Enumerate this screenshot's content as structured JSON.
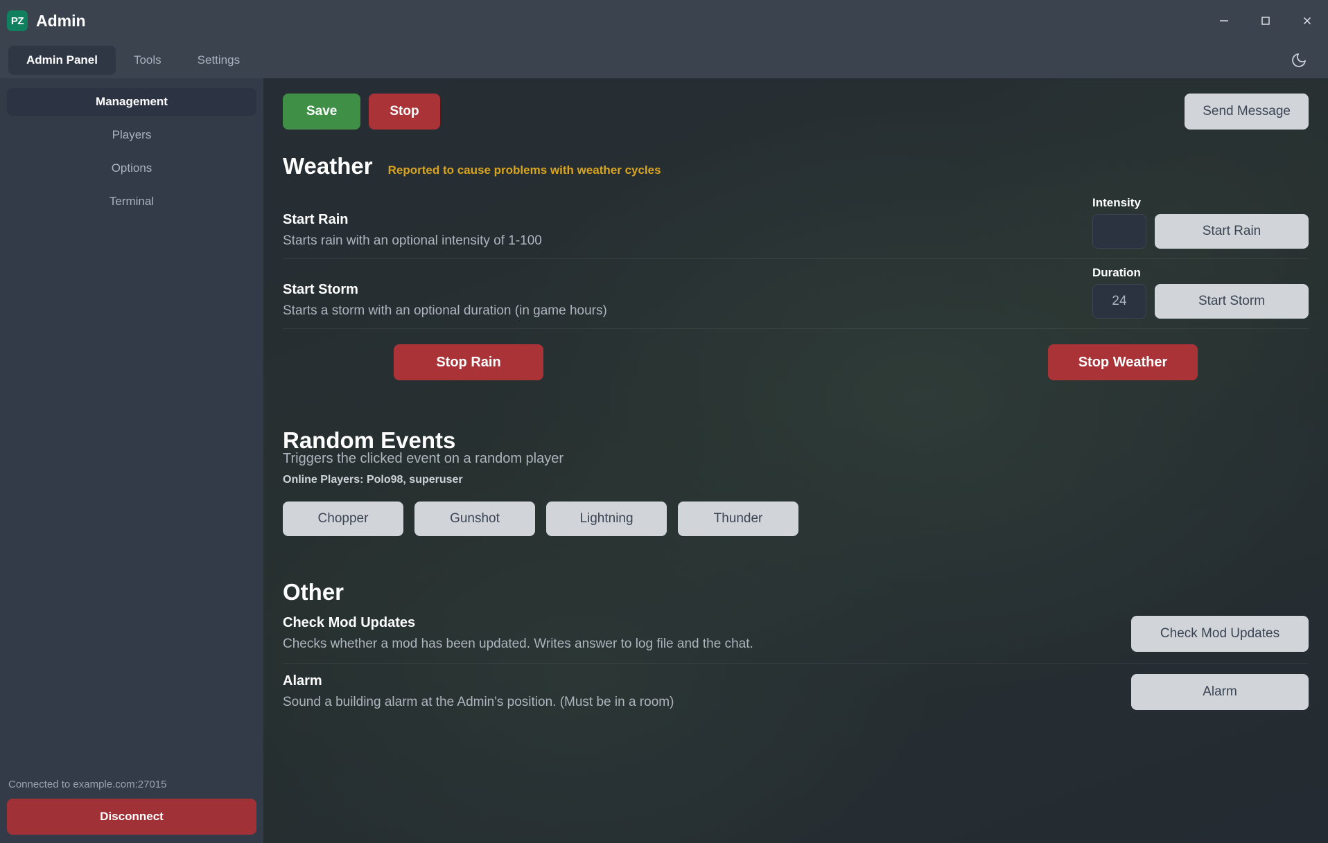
{
  "window": {
    "logo_text": "PZ",
    "title": "Admin",
    "minimize_icon": "minimize-icon",
    "maximize_icon": "maximize-icon",
    "close_icon": "close-icon"
  },
  "nav": {
    "tabs": [
      {
        "label": "Admin Panel",
        "active": true
      },
      {
        "label": "Tools",
        "active": false
      },
      {
        "label": "Settings",
        "active": false
      }
    ],
    "theme_toggle_icon": "moon-icon"
  },
  "sidebar": {
    "items": [
      {
        "label": "Management",
        "active": true
      },
      {
        "label": "Players",
        "active": false
      },
      {
        "label": "Options",
        "active": false
      },
      {
        "label": "Terminal",
        "active": false
      }
    ],
    "connection_status": "Connected to example.com:27015",
    "disconnect_label": "Disconnect"
  },
  "toolbar": {
    "save_label": "Save",
    "stop_label": "Stop",
    "send_message_label": "Send Message"
  },
  "weather": {
    "title": "Weather",
    "warning": "Reported to cause problems with weather cycles",
    "rows": [
      {
        "title": "Start Rain",
        "desc": "Starts rain with an optional intensity of 1-100",
        "field_label": "Intensity",
        "field_value": "",
        "field_placeholder": "",
        "button_label": "Start Rain"
      },
      {
        "title": "Start Storm",
        "desc": "Starts a storm with an optional duration (in game hours)",
        "field_label": "Duration",
        "field_value": "24",
        "field_placeholder": "24",
        "button_label": "Start Storm"
      }
    ],
    "stop_rain_label": "Stop Rain",
    "stop_weather_label": "Stop Weather"
  },
  "random_events": {
    "title": "Random Events",
    "subtitle": "Triggers the clicked event on a random player",
    "online_players": "Online Players: Polo98, superuser",
    "buttons": [
      {
        "label": "Chopper"
      },
      {
        "label": "Gunshot"
      },
      {
        "label": "Lightning"
      },
      {
        "label": "Thunder"
      }
    ]
  },
  "other": {
    "title": "Other",
    "rows": [
      {
        "title": "Check Mod Updates",
        "desc": "Checks whether a mod has been updated. Writes answer to log file and the chat.",
        "button_label": "Check Mod Updates"
      },
      {
        "title": "Alarm",
        "desc": "Sound a building alarm at the Admin's position. (Must be in a room)",
        "button_label": "Alarm"
      }
    ]
  },
  "colors": {
    "accent_green": "#3f8f46",
    "accent_red": "#a93337",
    "warning_yellow": "#d9a520",
    "logo_green": "#10805f",
    "light_button": "#d1d5d9"
  }
}
